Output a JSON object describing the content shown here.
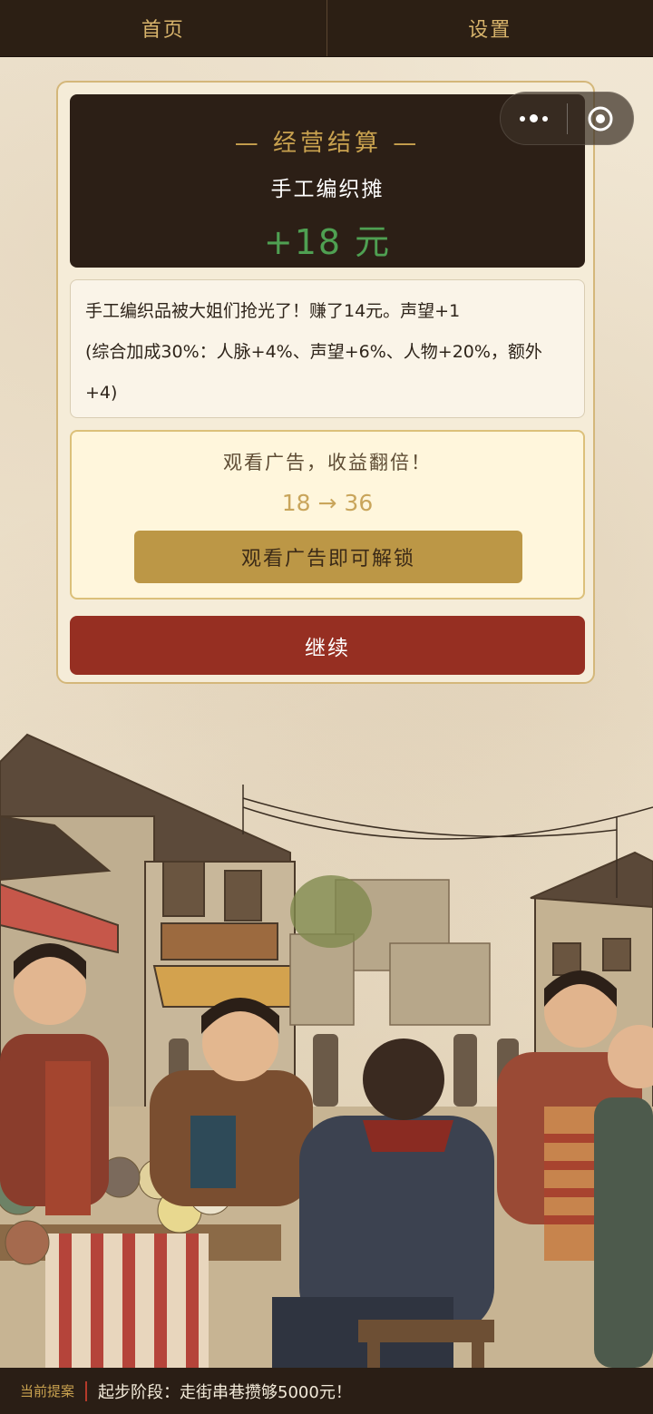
{
  "nav": {
    "tabs": [
      {
        "label": "首页"
      },
      {
        "label": "设置"
      }
    ]
  },
  "capsule": {
    "more_icon": "more-dots-icon",
    "close_icon": "target-close-icon"
  },
  "settlement": {
    "title": "— 经营结算 —",
    "stall_name": "手工编织摊",
    "amount": "+18 元"
  },
  "description": {
    "line1": "手工编织品被大姐们抢光了！赚了14元。声望+1",
    "line2": "(综合加成30%：人脉+4%、声望+6%、人物+20%，额外+4)"
  },
  "ad": {
    "title": "观看广告，收益翻倍！",
    "compare": "18 → 36",
    "button_label": "观看广告即可解锁"
  },
  "continue_label": "继续",
  "footer": {
    "label": "当前提案",
    "goal": "起步阶段：走街串巷攒够5000元！"
  },
  "colors": {
    "nav_bg": "#2c1f14",
    "gold": "#c9a24f",
    "profit_green": "#4fa052",
    "continue_red": "#962f22",
    "ad_button": "#bc9746"
  }
}
